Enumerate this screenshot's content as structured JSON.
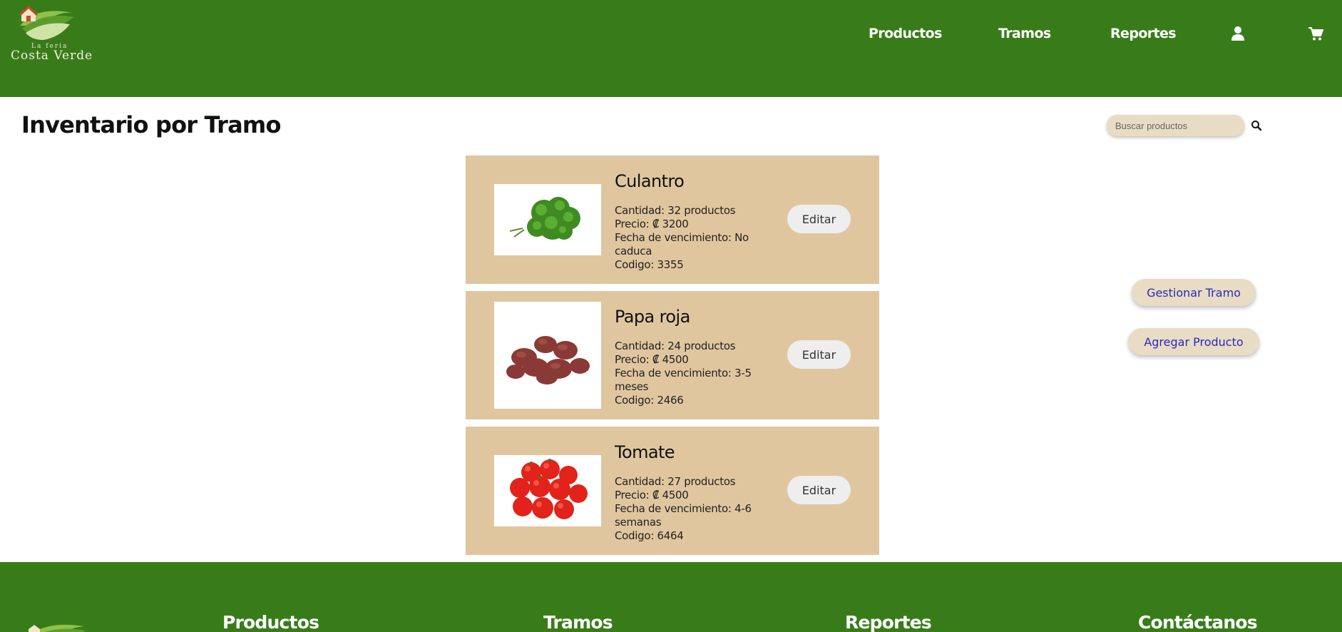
{
  "header": {
    "logo_small_text": "La feria",
    "logo_text": "Costa Verde",
    "nav": [
      {
        "label": "Productos"
      },
      {
        "label": "Tramos"
      },
      {
        "label": "Reportes"
      }
    ],
    "user_icon": "user-icon",
    "cart_icon": "cart-icon"
  },
  "main": {
    "title": "Inventario por Tramo",
    "search": {
      "placeholder": "Buscar productos",
      "value": ""
    },
    "products": [
      {
        "name": "Culantro",
        "cantidad": "Cantidad: 32 productos",
        "precio": "Precio: ₡ 3200",
        "vencimiento": "Fecha de vencimiento: No caduca",
        "codigo": "Codigo: 3355",
        "edit_label": "Editar",
        "image": "culantro-image"
      },
      {
        "name": "Papa roja",
        "cantidad": "Cantidad: 24 productos",
        "precio": "Precio: ₡ 4500",
        "vencimiento": "Fecha de vencimiento: 3-5 meses",
        "codigo": "Codigo: 2466",
        "edit_label": "Editar",
        "image": "papa-roja-image"
      },
      {
        "name": "Tomate",
        "cantidad": "Cantidad: 27 productos",
        "precio": "Precio: ₡ 4500",
        "vencimiento": "Fecha de vencimiento: 4-6 semanas",
        "codigo": "Codigo: 6464",
        "edit_label": "Editar",
        "image": "tomate-image"
      }
    ],
    "actions": {
      "gestionar_label": "Gestionar Tramo",
      "agregar_label": "Agregar Producto"
    }
  },
  "footer": {
    "links": [
      {
        "label": "Productos"
      },
      {
        "label": "Tramos"
      },
      {
        "label": "Reportes"
      },
      {
        "label": "Contáctanos"
      }
    ]
  },
  "colors": {
    "brand_green": "#387c1a",
    "card_tan": "#e0c69f",
    "input_tan": "#e8dcc4",
    "action_text": "#2a2ab8"
  }
}
